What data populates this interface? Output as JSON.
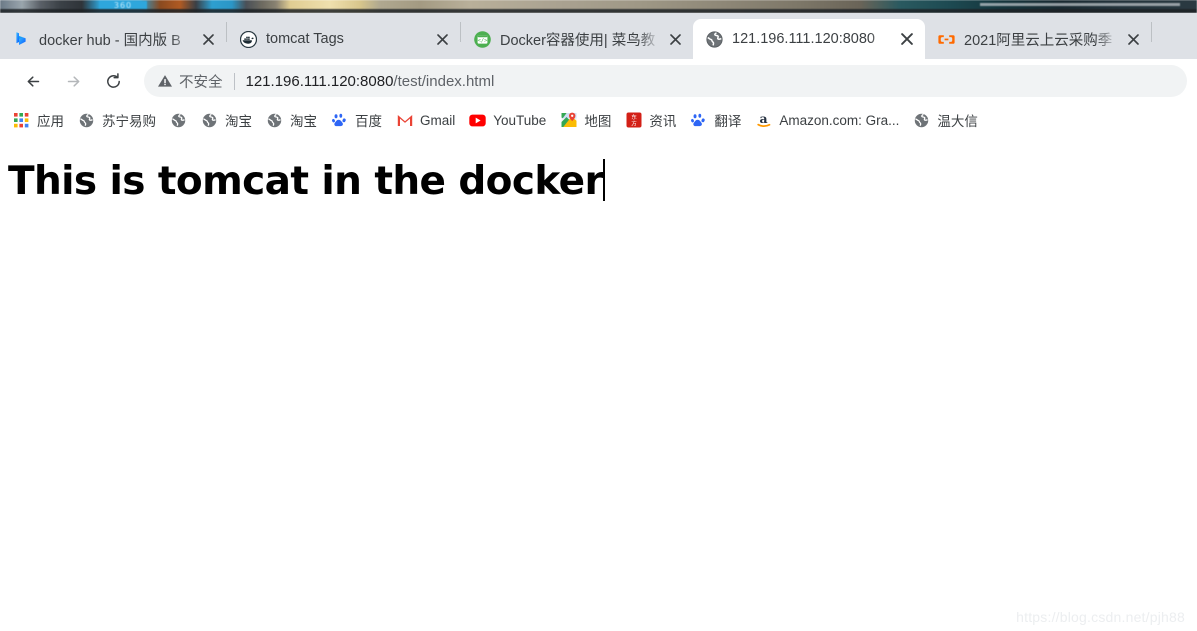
{
  "window": {
    "desktop_strip_label": "360"
  },
  "tabs": [
    {
      "title": "docker hub - 国内版 B",
      "favicon": "bing-icon",
      "active": false,
      "close_label": "×"
    },
    {
      "title": "tomcat Tags",
      "favicon": "docker-whale-icon",
      "active": false,
      "close_label": "×"
    },
    {
      "title": "Docker容器使用| 菜鸟教",
      "favicon": "runoob-icon",
      "active": false,
      "close_label": "×"
    },
    {
      "title": "121.196.111.120:8080",
      "favicon": "globe-icon",
      "active": true,
      "close_label": "×"
    },
    {
      "title": "2021阿里云上云采购季",
      "favicon": "aliyun-icon",
      "active": false,
      "close_label": "×"
    }
  ],
  "toolbar": {
    "back_label": "←",
    "forward_label": "→",
    "reload_label": "↻",
    "security_text": "不安全",
    "url_host": "121.196.111.120:8080",
    "url_path": "/test/index.html",
    "url_full": "121.196.111.120:8080/test/index.html"
  },
  "bookmarks": [
    {
      "label": "应用",
      "icon": "apps-grid-icon"
    },
    {
      "label": "苏宁易购",
      "icon": "globe-icon"
    },
    {
      "label": "",
      "icon": "globe-icon"
    },
    {
      "label": "淘宝",
      "icon": "globe-icon"
    },
    {
      "label": "淘宝",
      "icon": "globe-icon"
    },
    {
      "label": "百度",
      "icon": "baidu-icon"
    },
    {
      "label": "Gmail",
      "icon": "gmail-icon"
    },
    {
      "label": "YouTube",
      "icon": "youtube-icon"
    },
    {
      "label": "地图",
      "icon": "google-maps-icon"
    },
    {
      "label": "资讯",
      "icon": "eastmoney-icon"
    },
    {
      "label": "翻译",
      "icon": "baidu-icon"
    },
    {
      "label": "Amazon.com: Gra...",
      "icon": "amazon-icon"
    },
    {
      "label": "温大信",
      "icon": "globe-icon"
    }
  ],
  "page": {
    "heading": "This is tomcat in the docker",
    "watermark": "https://blog.csdn.net/pjh88"
  },
  "colors": {
    "tabstrip_bg": "#dee1e6",
    "omnibox_bg": "#f1f3f4",
    "text_primary": "#202124",
    "text_secondary": "#5f6368",
    "page_bg": "#ffffff"
  }
}
